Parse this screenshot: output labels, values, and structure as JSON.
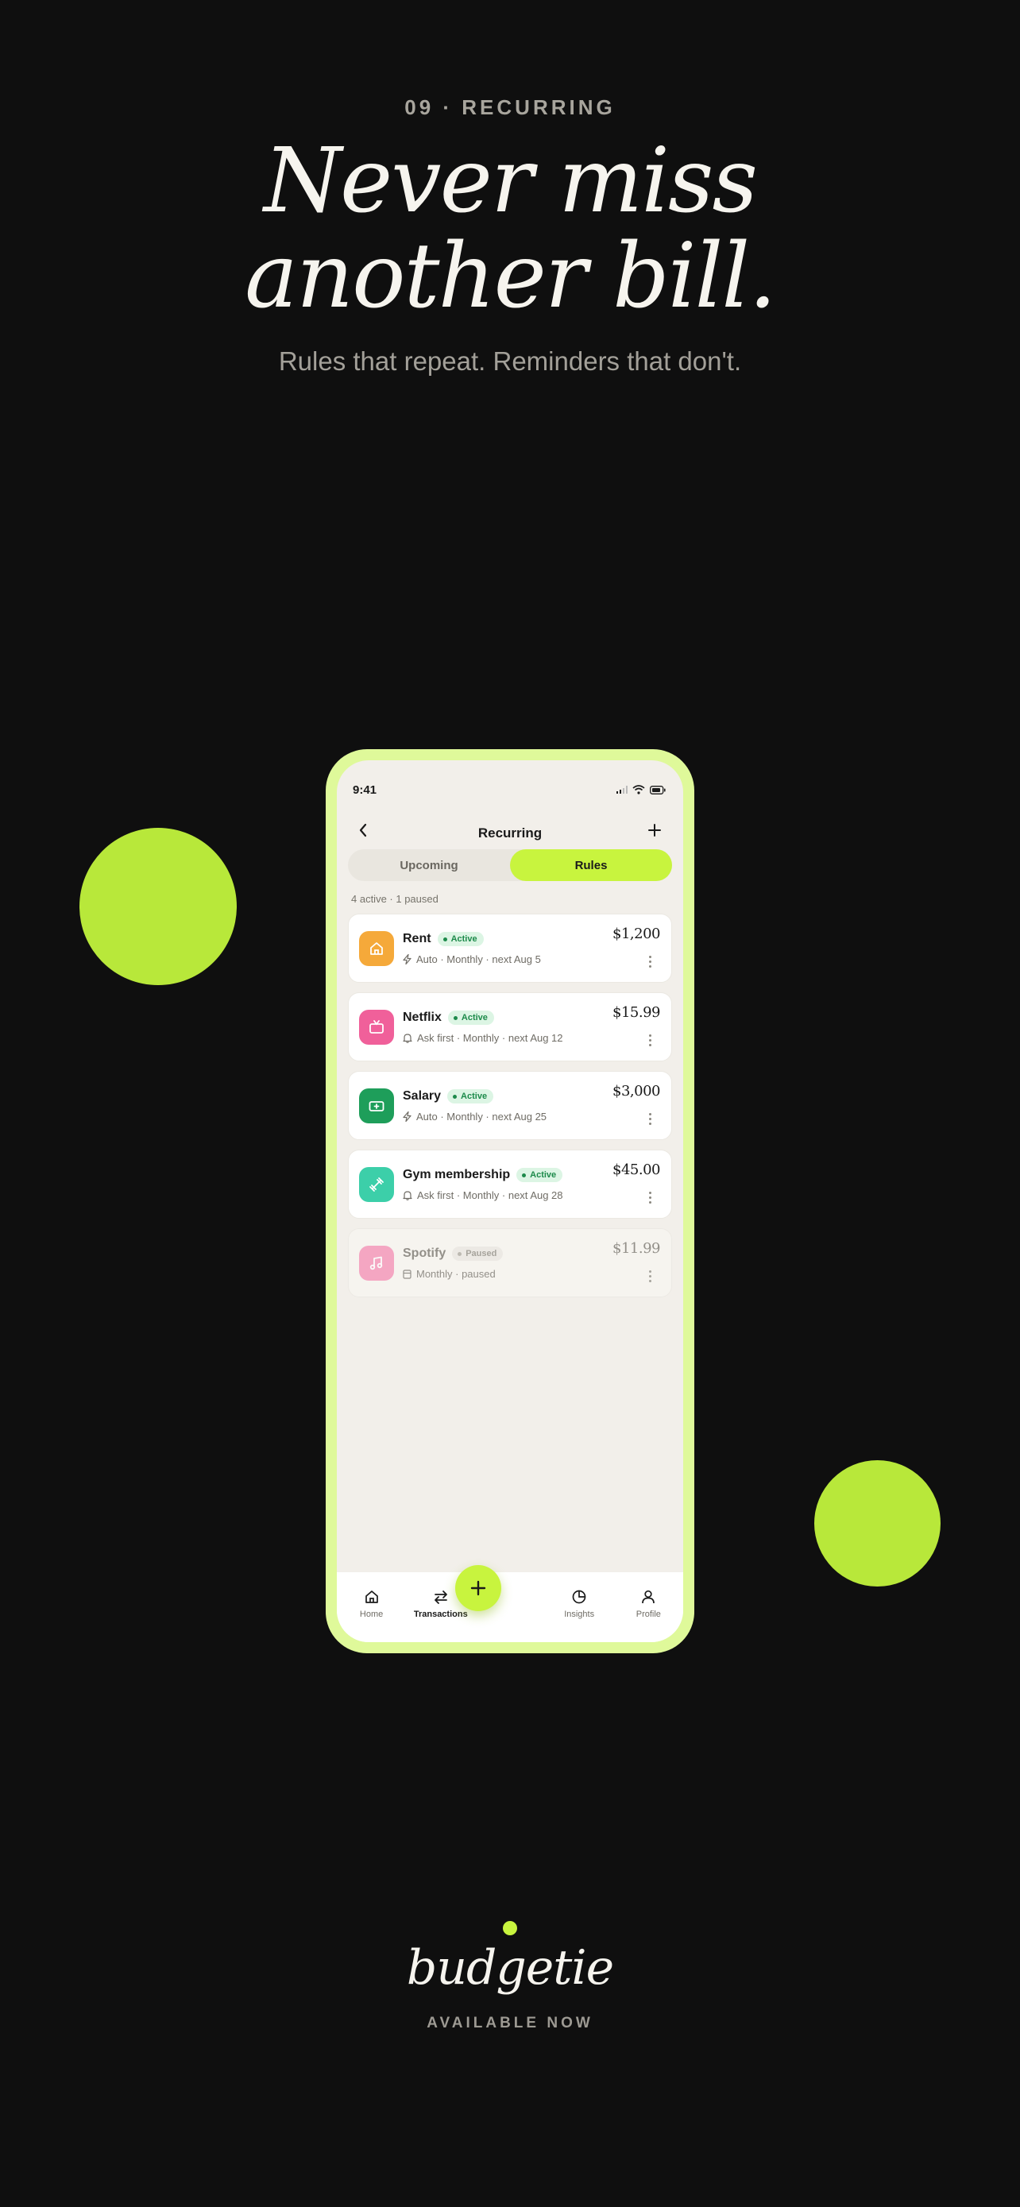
{
  "page": {
    "eyebrow": "09 · RECURRING",
    "headline_line1": "Never miss",
    "headline_line2": "another bill.",
    "subtitle": "Rules that repeat. Reminders that don't."
  },
  "status_bar": {
    "time": "9:41"
  },
  "nav": {
    "title": "Recurring",
    "back_icon": "chevron-left-icon",
    "add_icon": "plus-icon"
  },
  "segments": {
    "upcoming": "Upcoming",
    "rules": "Rules",
    "selected": "Rules"
  },
  "summary": "4 active · 1 paused",
  "rules": [
    {
      "name": "Rent",
      "status": "Active",
      "amount": "$1,200",
      "mode": "Auto",
      "schedule": "Monthly · next Aug 5",
      "meta": "Auto · Monthly · next Aug 5",
      "icon": "home-icon",
      "color": "#f5a93a"
    },
    {
      "name": "Netflix",
      "status": "Active",
      "amount": "$15.99",
      "mode": "Ask first",
      "meta": "Ask first · Monthly · next Aug 12",
      "icon": "tv-icon",
      "color": "#f0609a"
    },
    {
      "name": "Salary",
      "status": "Active",
      "amount": "$3,000",
      "mode": "Auto",
      "meta": "Auto · Monthly · next Aug 25",
      "icon": "banknote-icon",
      "color": "#1e9e5a"
    },
    {
      "name": "Gym membership",
      "status": "Active",
      "amount": "$45.00",
      "mode": "Ask first",
      "meta": "Ask first · Monthly · next Aug 28",
      "icon": "dumbbell-icon",
      "color": "#3ccfa9"
    },
    {
      "name": "Spotify",
      "status": "Paused",
      "amount": "$11.99",
      "meta": "Monthly · paused",
      "icon": "music-icon",
      "color": "#f58ab4"
    }
  ],
  "tabbar": {
    "home": "Home",
    "transactions": "Transactions",
    "insights": "Insights",
    "profile": "Profile",
    "current": "Transactions"
  },
  "brand": {
    "name": "budgetie",
    "tagline": "AVAILABLE NOW"
  },
  "colors": {
    "accent": "#c8f43e",
    "background": "#0f0f0f",
    "phone_frame": "#dff99a"
  }
}
